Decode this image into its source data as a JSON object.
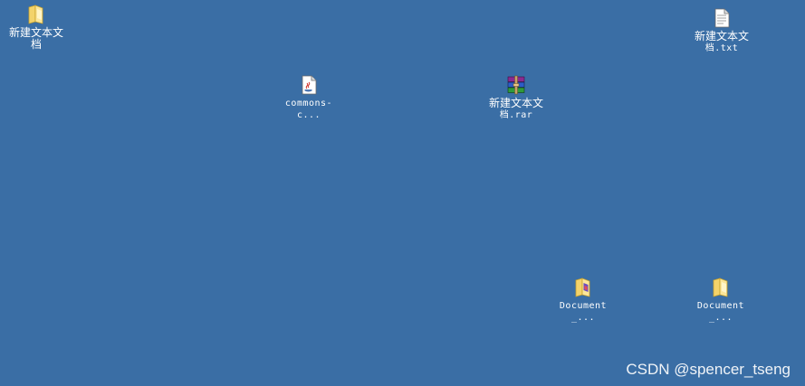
{
  "desktop": {
    "background_color": "#3a6ea5",
    "icons": [
      {
        "name": "folder-new-doc",
        "icon": "folder-icon",
        "line1": "新建文本文档",
        "line2": ""
      },
      {
        "name": "file-new-txt",
        "icon": "text-file-icon",
        "line1": "新建文本文",
        "line2": "档.txt"
      },
      {
        "name": "file-commons",
        "icon": "java-file-icon",
        "line1": "commons-c...",
        "line2": ""
      },
      {
        "name": "file-new-rar",
        "icon": "rar-archive-icon",
        "line1": "新建文本文",
        "line2": "档.rar"
      },
      {
        "name": "folder-document-1",
        "icon": "documents-folder-icon",
        "line1": "Document_...",
        "line2": ""
      },
      {
        "name": "folder-document-2",
        "icon": "folder-icon",
        "line1": "Document_...",
        "line2": ""
      }
    ]
  },
  "watermark": "CSDN @spencer_tseng"
}
